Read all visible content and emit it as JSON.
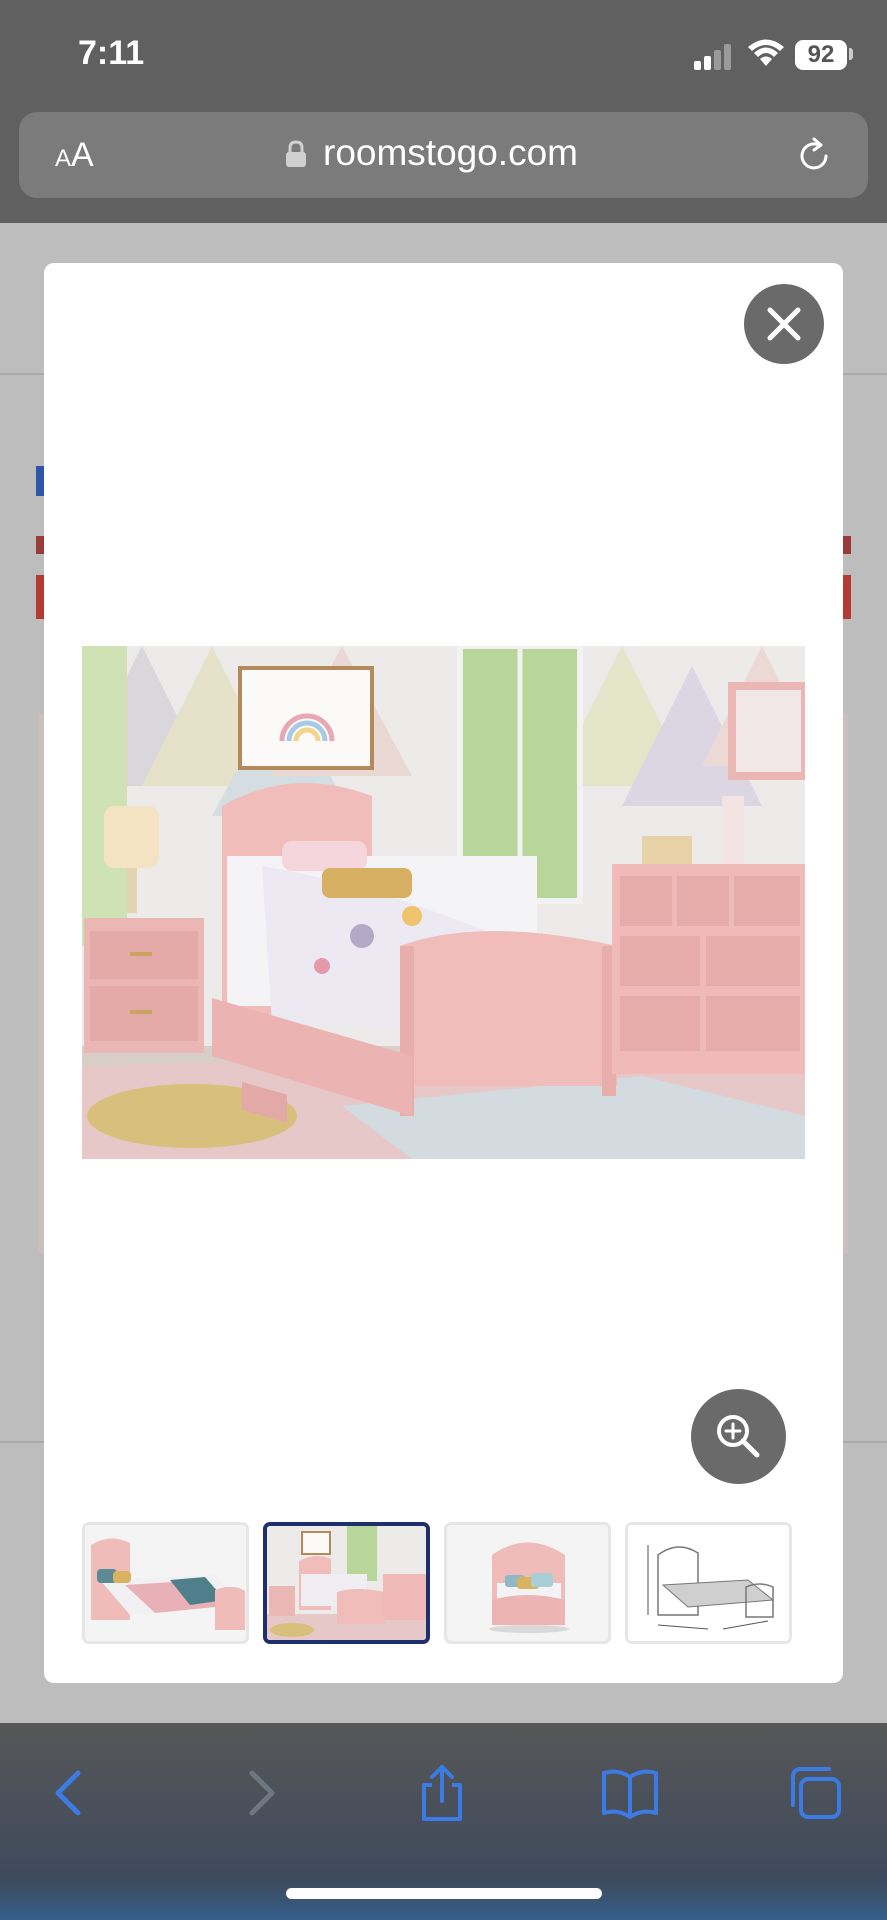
{
  "status_bar": {
    "time": "7:11",
    "battery": "92"
  },
  "browser": {
    "text_size_small": "A",
    "text_size_large": "A",
    "domain": "roomstogo.com"
  },
  "modal": {
    "main_image_alt": "Pink bedroom set with trundle bed, nightstand and dresser",
    "thumbnails": [
      {
        "alt": "Pink twin bed with blue and pink bedding",
        "selected": false
      },
      {
        "alt": "Pink bedroom set in room scene",
        "selected": true
      },
      {
        "alt": "Pink bed front view",
        "selected": false
      },
      {
        "alt": "Bed dimension drawing",
        "selected": false
      }
    ]
  },
  "colors": {
    "accent": "#1e2f6e",
    "ios_blue": "#3c7be3",
    "modal_button": "#6a6a6a"
  },
  "icons": [
    "signal-icon",
    "wifi-icon",
    "lock-icon",
    "reload-icon",
    "close-icon",
    "zoom-in-icon",
    "back-icon",
    "forward-icon",
    "share-icon",
    "bookmarks-icon",
    "tabs-icon"
  ]
}
